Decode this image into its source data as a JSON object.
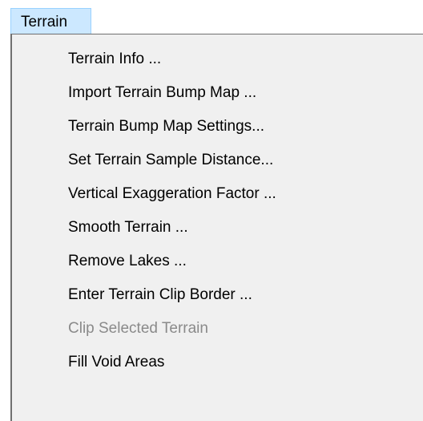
{
  "menubar": {
    "active_menu": "Terrain"
  },
  "dropdown": {
    "items": [
      {
        "label": "Terrain Info ...",
        "enabled": true
      },
      {
        "label": "Import Terrain Bump Map ...",
        "enabled": true
      },
      {
        "label": "Terrain Bump Map Settings...",
        "enabled": true
      },
      {
        "label": "Set Terrain Sample Distance...",
        "enabled": true
      },
      {
        "label": "Vertical Exaggeration Factor ...",
        "enabled": true
      },
      {
        "label": "Smooth Terrain ...",
        "enabled": true
      },
      {
        "label": "Remove Lakes ...",
        "enabled": true
      },
      {
        "label": "Enter Terrain Clip Border ...",
        "enabled": true
      },
      {
        "label": "Clip Selected Terrain",
        "enabled": false
      },
      {
        "label": "Fill Void Areas",
        "enabled": true
      }
    ]
  },
  "colors": {
    "menu_highlight": "#cce8ff",
    "menu_highlight_border": "#99d1ff",
    "dropdown_background": "#f0f0f0",
    "disabled_text": "#8a8a8a"
  }
}
